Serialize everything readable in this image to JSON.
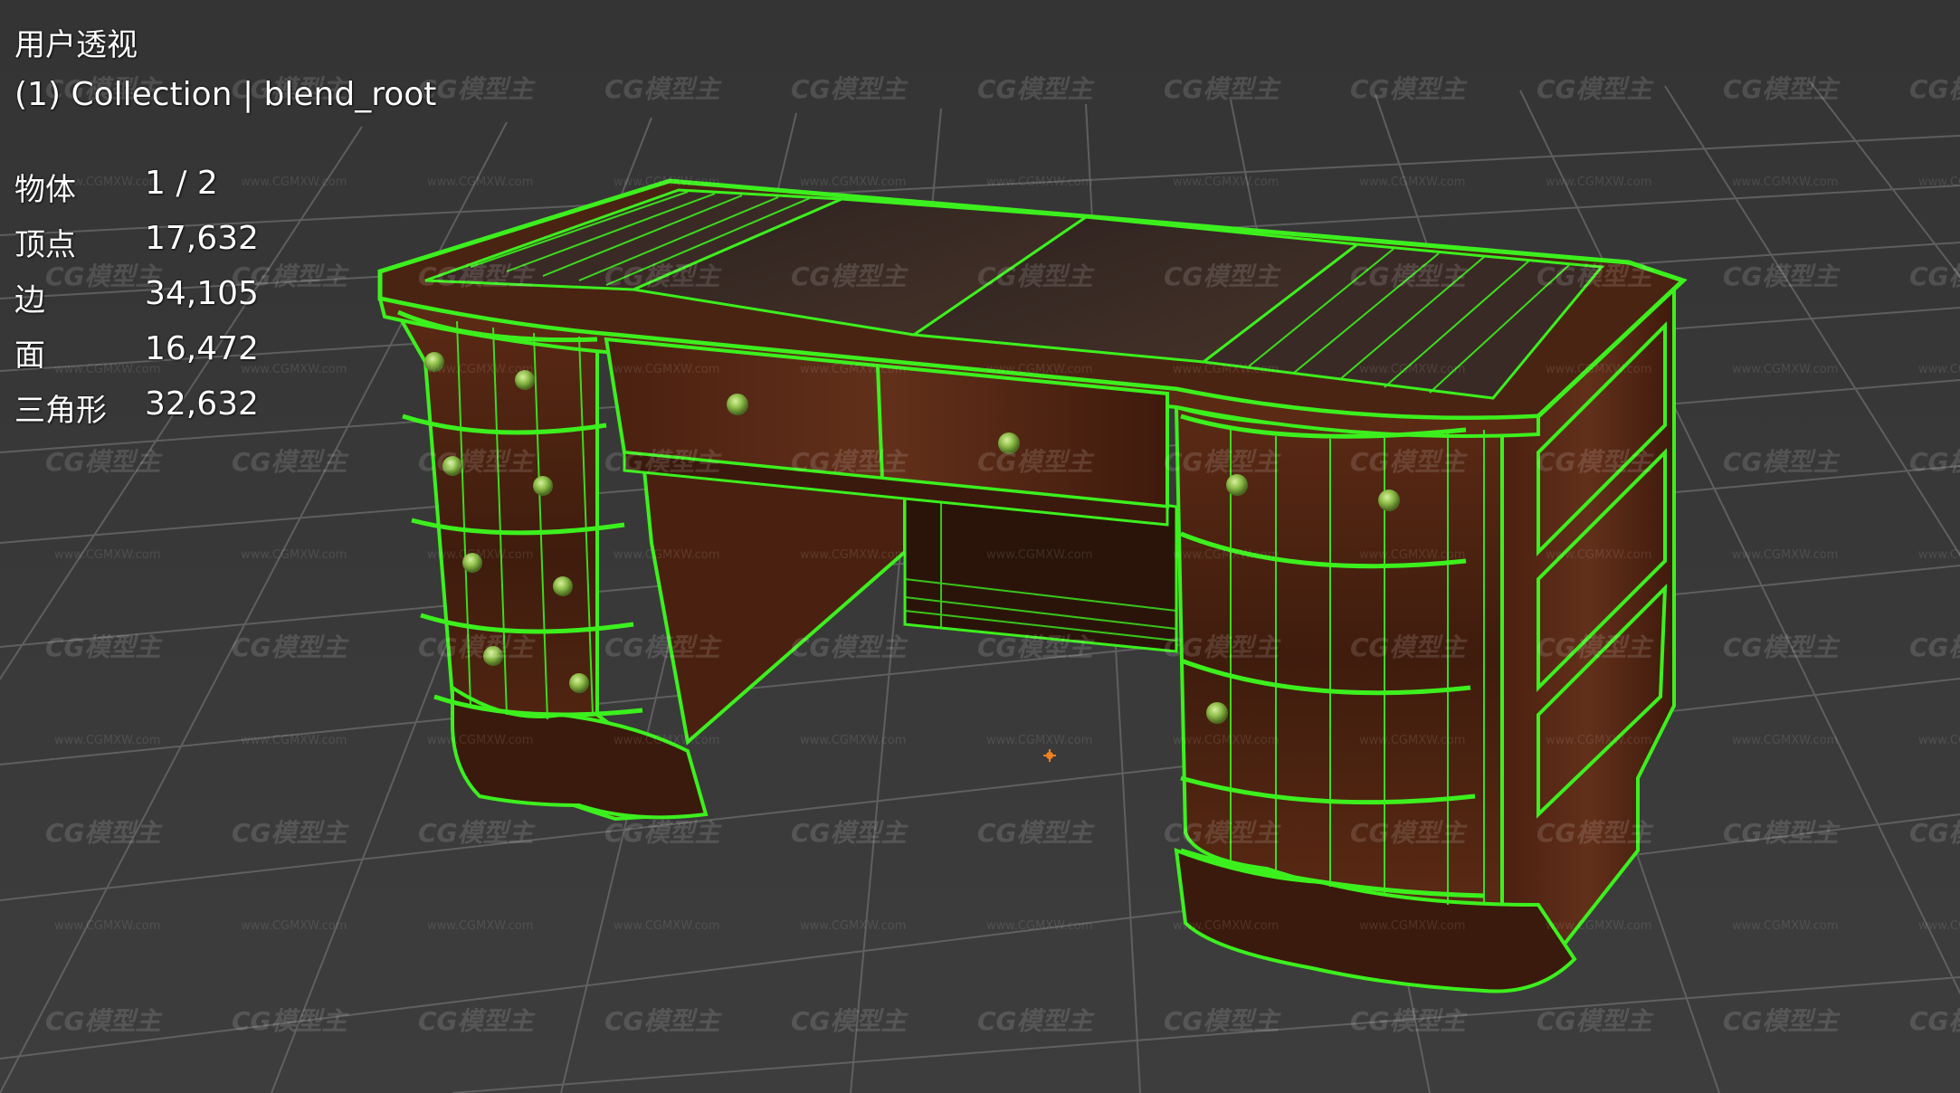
{
  "viewport": {
    "view_name": "用户透视",
    "collection_label": "(1) Collection | blend_root",
    "stats": [
      {
        "label": "物体",
        "value": "1 / 2"
      },
      {
        "label": "顶点",
        "value": "17,632"
      },
      {
        "label": "边",
        "value": "34,105"
      },
      {
        "label": "面",
        "value": "16,472"
      },
      {
        "label": "三角形",
        "value": "32,632"
      }
    ]
  },
  "watermark": {
    "logo_text": "CG模型主",
    "url_text": "www.CGMXW.com"
  },
  "colors": {
    "background": "#3a3a3a",
    "grid_line": "#6e6e6e",
    "wireframe": "#3cf01e",
    "wood_dark": "#3a1a0c",
    "wood_mid": "#5a2a14",
    "leather": "#3b2a24",
    "knob": "#8fbf4a",
    "origin_marker": "#f08020"
  },
  "icons": [
    "origin-marker-icon"
  ]
}
